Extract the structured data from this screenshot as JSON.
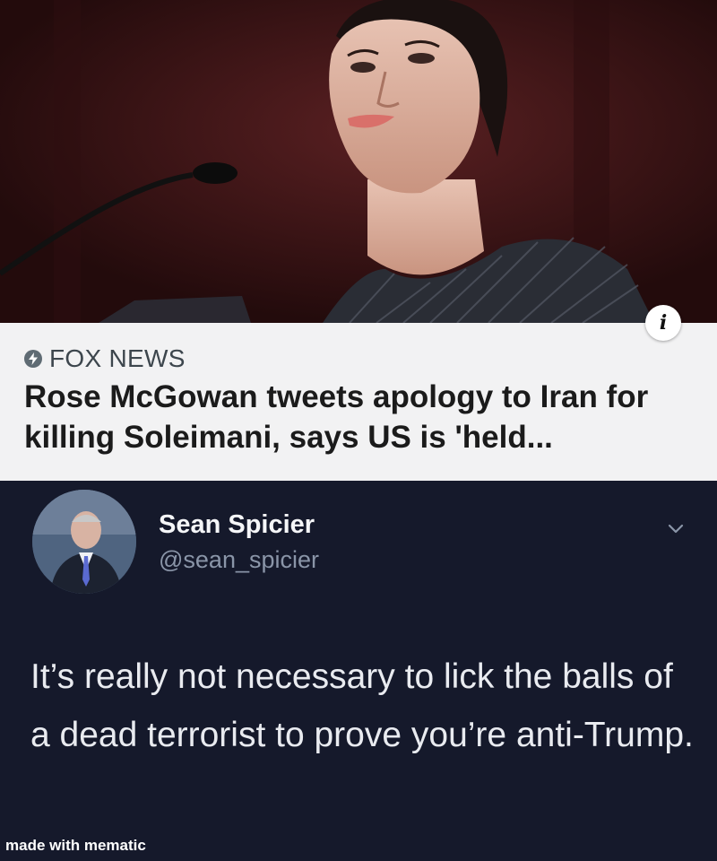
{
  "news_card": {
    "source": "FOX NEWS",
    "headline": "Rose McGowan tweets apology to Iran for killing Soleimani, says US is 'held...",
    "info_icon": "info-icon",
    "source_icon": "bolt-icon"
  },
  "tweet": {
    "display_name": "Sean Spicier",
    "handle": "@sean_spicier",
    "text": "It’s really not necessary to lick the balls of a dead terrorist to prove you’re anti-Trump.",
    "menu_icon": "chevron-down-icon"
  },
  "watermark": "made with mematic",
  "colors": {
    "card_background": "#f2f2f3",
    "tweet_background": "#15192b",
    "handle": "#8a95a8"
  }
}
